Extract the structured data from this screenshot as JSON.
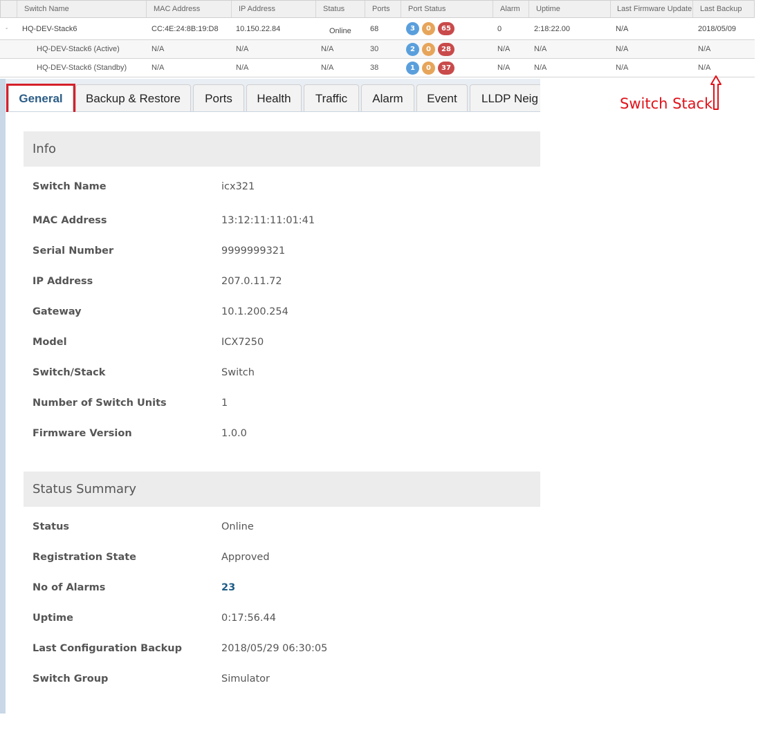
{
  "grid": {
    "columns": [
      "Switch Name",
      "MAC Address",
      "IP Address",
      "Status",
      "Ports",
      "Port Status",
      "Alarm",
      "Uptime",
      "Last Firmware Update",
      "Last Backup"
    ],
    "main": {
      "expander": "-",
      "name": "HQ-DEV-Stack6",
      "mac": "CC:4E:24:8B:19:D8",
      "ip": "10.150.22.84",
      "status": "Online",
      "ports": "68",
      "port_status": {
        "blue": "3",
        "orange": "0",
        "red": "65"
      },
      "alarm": "0",
      "uptime": "2:18:22.00",
      "firmware": "N/A",
      "backup": "2018/05/09"
    },
    "sub_rows": [
      {
        "name": "HQ-DEV-Stack6 (Active)",
        "mac": "N/A",
        "ip": "N/A",
        "status": "N/A",
        "ports": "30",
        "port_status": {
          "blue": "2",
          "orange": "0",
          "red": "28"
        },
        "alarm": "N/A",
        "uptime": "N/A",
        "firmware": "N/A",
        "backup": "N/A"
      },
      {
        "name": "HQ-DEV-Stack6 (Standby)",
        "mac": "N/A",
        "ip": "N/A",
        "status": "N/A",
        "ports": "38",
        "port_status": {
          "blue": "1",
          "orange": "0",
          "red": "37"
        },
        "alarm": "N/A",
        "uptime": "N/A",
        "firmware": "N/A",
        "backup": "N/A"
      }
    ]
  },
  "annotation": {
    "text": "Switch Stack",
    "color": "#e0121a"
  },
  "tabs": [
    "General",
    "Backup & Restore",
    "Ports",
    "Health",
    "Traffic",
    "Alarm",
    "Event",
    "LLDP Neig"
  ],
  "active_tab": "General",
  "info": {
    "title": "Info",
    "fields": [
      {
        "label": "Switch Name",
        "value": "icx321"
      },
      {
        "label": "MAC Address",
        "value": "13:12:11:11:01:41"
      },
      {
        "label": "Serial Number",
        "value": "9999999321"
      },
      {
        "label": "IP Address",
        "value": "207.0.11.72"
      },
      {
        "label": "Gateway",
        "value": "10.1.200.254"
      },
      {
        "label": "Model",
        "value": "ICX7250"
      },
      {
        "label": "Switch/Stack",
        "value": "Switch"
      },
      {
        "label": "Number of Switch Units",
        "value": "1"
      },
      {
        "label": "Firmware Version",
        "value": "1.0.0"
      }
    ]
  },
  "status_summary": {
    "title": "Status Summary",
    "fields": [
      {
        "label": "Status",
        "value": "Online"
      },
      {
        "label": "Registration State",
        "value": "Approved"
      },
      {
        "label": "No of Alarms",
        "value": "23"
      },
      {
        "label": "Uptime",
        "value": "0:17:56.44"
      },
      {
        "label": "Last Configuration Backup",
        "value": "2018/05/29 06:30:05"
      },
      {
        "label": "Switch Group",
        "value": "Simulator"
      }
    ]
  },
  "colors": {
    "accent": "#2b5d86",
    "badge_blue": "#5a9fdc",
    "badge_orange": "#e6a55a",
    "badge_red": "#c94a4a",
    "highlight_red": "#d6202a"
  }
}
